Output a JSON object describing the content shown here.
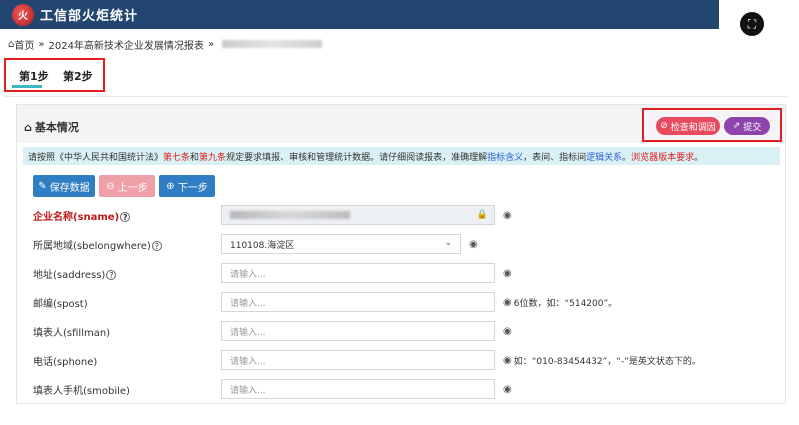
{
  "app": {
    "title": "工信部火炬统计",
    "logo_text": "火"
  },
  "breadcrumb": {
    "home": "首页",
    "current": "2024年高新技术企业发展情况报表"
  },
  "tabs": [
    {
      "label": "第1步"
    },
    {
      "label": "第2步"
    }
  ],
  "section": {
    "title": "基本情况"
  },
  "actions": {
    "check": "检查和调因",
    "submit": "提交"
  },
  "notice": {
    "p1": "请按照《中华人民共和国统计法》",
    "art7": "第七条",
    "and": " 和 ",
    "art9": "第九条",
    "p2": " 规定要求填报、审核和管理统计数据。请仔细阅读报表，准确理解",
    "link1": "指标含义",
    "p3": "，表间、指标间",
    "link2": "逻辑关系",
    "p4": "。",
    "link3": "浏览器版本要求",
    "p5": "。"
  },
  "toolbar": {
    "save": "保存数据",
    "prev": "上一步",
    "next": "下一步"
  },
  "form": {
    "rows": [
      {
        "label": "企业名称(sname)",
        "value": "",
        "placeholder": ""
      },
      {
        "label": "所属地域(sbelongwhere)",
        "value": "110108.海淀区"
      },
      {
        "label": "地址(saddress)",
        "placeholder": "请输入..."
      },
      {
        "label": "邮编(spost)",
        "placeholder": "请输入...",
        "hint": "6位数，如：“514200”。"
      },
      {
        "label": "填表人(sfillman)",
        "placeholder": "请输入..."
      },
      {
        "label": "电话(sphone)",
        "placeholder": "请输入...",
        "hint": "如：“010-83454432”，“-”是英文状态下的。"
      },
      {
        "label": "填表人手机(smobile)",
        "placeholder": "请输入..."
      }
    ]
  },
  "colors": {
    "header": "#22466f",
    "primary": "#2f7ec3",
    "danger": "#e84a5f",
    "purple": "#8e44ad",
    "notice_bg": "#d9f1f4"
  }
}
